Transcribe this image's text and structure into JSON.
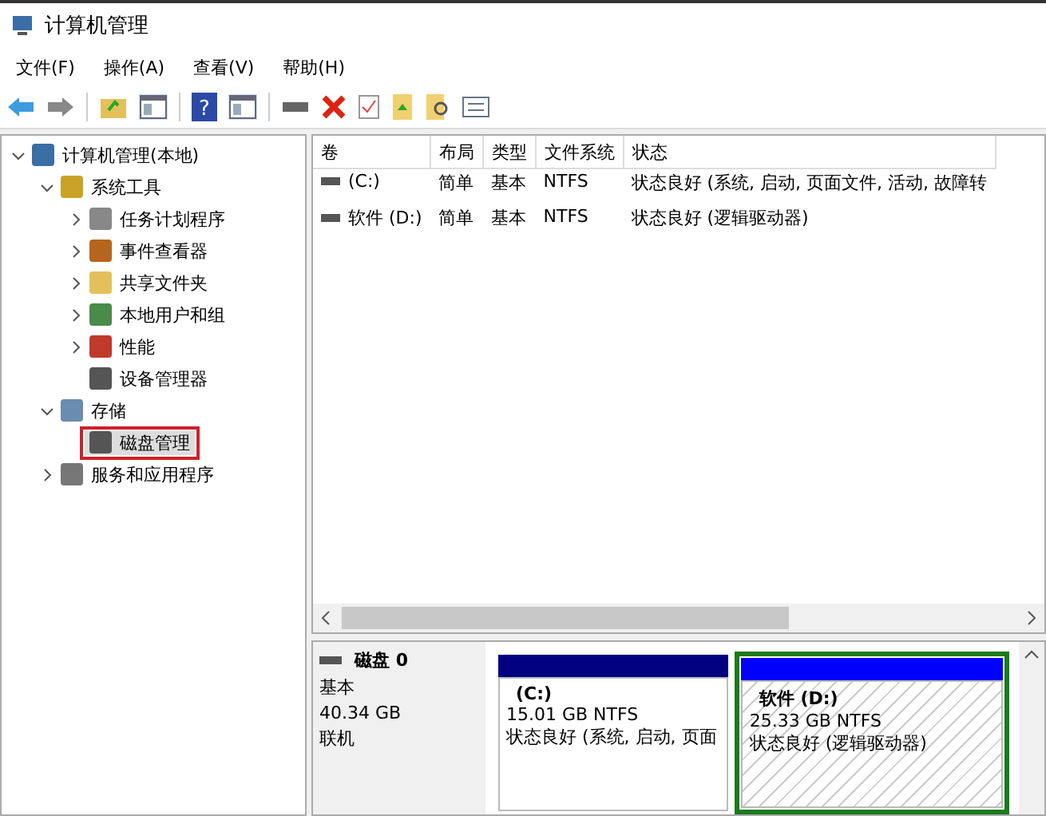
{
  "window": {
    "title": "计算机管理"
  },
  "menu": [
    "文件(F)",
    "操作(A)",
    "查看(V)",
    "帮助(H)"
  ],
  "toolbar": [
    {
      "kind": "back"
    },
    {
      "kind": "forward"
    },
    {
      "kind": "sep"
    },
    {
      "kind": "folder-up"
    },
    {
      "kind": "panel"
    },
    {
      "kind": "sep"
    },
    {
      "kind": "help",
      "label": "?"
    },
    {
      "kind": "panel2"
    },
    {
      "kind": "sep"
    },
    {
      "kind": "drive"
    },
    {
      "kind": "delete"
    },
    {
      "kind": "check"
    },
    {
      "kind": "folder-arrow"
    },
    {
      "kind": "folder-search"
    },
    {
      "kind": "list"
    }
  ],
  "tree": [
    {
      "label": "计算机管理(本地)",
      "expanded": true,
      "selected": false,
      "children": [
        {
          "label": "系统工具",
          "expanded": true,
          "selected": false,
          "children": [
            {
              "label": "任务计划程序",
              "expanded": false,
              "selected": false
            },
            {
              "label": "事件查看器",
              "expanded": false,
              "selected": false
            },
            {
              "label": "共享文件夹",
              "expanded": false,
              "selected": false
            },
            {
              "label": "本地用户和组",
              "expanded": false,
              "selected": false
            },
            {
              "label": "性能",
              "expanded": false,
              "selected": false
            },
            {
              "label": "设备管理器",
              "selected": false
            }
          ]
        },
        {
          "label": "存储",
          "expanded": true,
          "selected": false,
          "children": [
            {
              "label": "磁盘管理",
              "selected": true
            }
          ]
        },
        {
          "label": "服务和应用程序",
          "expanded": false,
          "selected": false
        }
      ]
    }
  ],
  "table": {
    "columns": [
      "卷",
      "布局",
      "类型",
      "文件系统",
      "状态"
    ],
    "rows": [
      [
        "(C:)",
        "简单",
        "基本",
        "NTFS",
        "状态良好 (系统, 启动, 页面文件, 活动, 故障转"
      ],
      [
        "软件 (D:)",
        "简单",
        "基本",
        "NTFS",
        "状态良好 (逻辑驱动器)"
      ]
    ]
  },
  "disk": {
    "name": "磁盘 0",
    "type": "基本",
    "size": "40.34 GB",
    "status": "联机",
    "partitions": [
      {
        "kind": "primary",
        "name": "(C:)",
        "size": "15.01 GB NTFS",
        "status": "状态良好 (系统, 启动, 页面",
        "color": "#000080",
        "selected": false
      },
      {
        "kind": "logical",
        "name": "软件  (D:)",
        "size": "25.33 GB NTFS",
        "status": "状态良好 (逻辑驱动器)",
        "color": "#0000ff",
        "selected": true
      }
    ]
  }
}
